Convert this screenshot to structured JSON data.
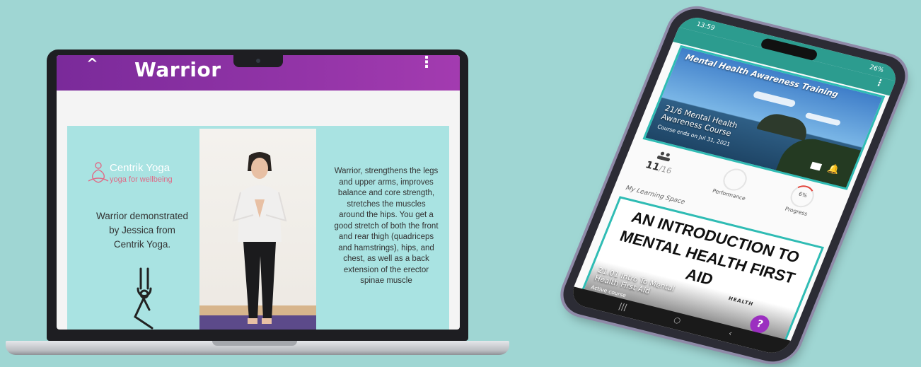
{
  "laptop": {
    "app_bar": {
      "back_icon": "chevron-up-icon",
      "title": "Warrior",
      "more_icon": "more-vertical-icon",
      "color_start": "#7a2a9a",
      "color_end": "#a33bb0"
    },
    "slide": {
      "logo_name": "Centrik Yoga",
      "logo_tagline": "yoga for wellbeing",
      "left_caption": "Warrior demonstrated by Jessica from Centrik Yoga.",
      "right_caption": "Warrior, strengthens the legs and upper arms, improves balance and core strength, stretches the muscles around the hips. You get a good stretch of both the front and rear thigh (quadriceps and hamstrings), hips, and chest, as well as a back extension of the erector spinae muscle",
      "background": "#a9e3e2"
    }
  },
  "phone": {
    "status": {
      "time": "13:59",
      "right": "26%"
    },
    "hero": {
      "title": "Mental Health Awareness Training",
      "course_title": "21/6 Mental Health Awareness Course",
      "course_subtitle": "Course ends on Jul 31, 2021"
    },
    "stats": {
      "members_count": "11",
      "members_total": "/16",
      "performance_label": "Performance",
      "progress_value": "6%",
      "progress_label": "Progress",
      "progress_fraction": 0.06
    },
    "section_label": "My Learning Space",
    "card": {
      "headline": "AN INTRODUCTION TO MENTAL HEALTH FIRST AID",
      "course_title": "21.01 Intro To Mental Health First Aid",
      "course_subtitle": "Active course",
      "help_label": "?",
      "tiles_text": "HEALTH"
    },
    "accent": "#2c9c8f"
  }
}
